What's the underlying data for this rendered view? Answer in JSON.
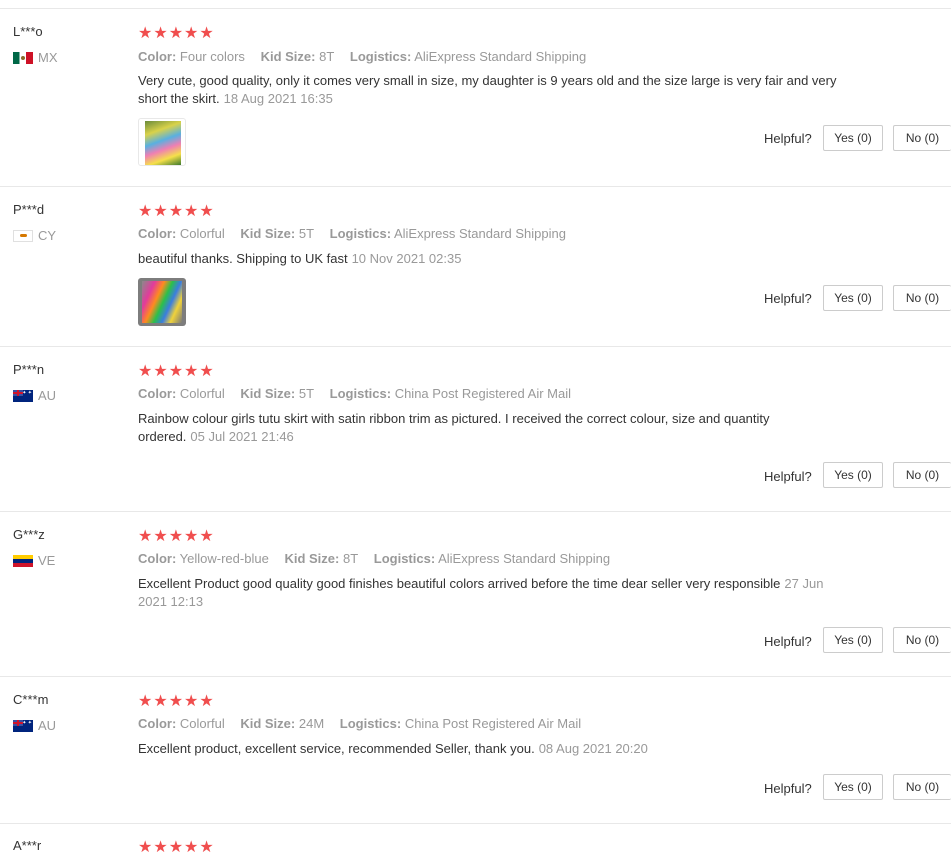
{
  "helpful_label": "Helpful?",
  "colors": {
    "star": "#f04e4e",
    "border": "#e8e8e8",
    "muted": "#999999"
  },
  "reviews": [
    {
      "user": "L***o",
      "country": "MX",
      "flag": "mexico-flag-icon",
      "stars": "★★★★★",
      "color_label": "Color:",
      "color": "Four colors",
      "size_label": "Kid Size:",
      "size": "8T",
      "logistics_label": "Logistics:",
      "logistics": "AliExpress Standard Shipping",
      "text": "Very cute, good quality, only it comes very small in size, my daughter is 9 years old and the size large is very fair and very short the skirt.",
      "date": "18 Aug 2021 16:35",
      "yes": "Yes (0)",
      "no": "No (0)",
      "has_photo": true
    },
    {
      "user": "P***d",
      "country": "CY",
      "flag": "cyprus-flag-icon",
      "stars": "★★★★★",
      "color_label": "Color:",
      "color": "Colorful",
      "size_label": "Kid Size:",
      "size": "5T",
      "logistics_label": "Logistics:",
      "logistics": "AliExpress Standard Shipping",
      "text": "beautiful thanks. Shipping to UK fast",
      "date": "10 Nov 2021 02:35",
      "yes": "Yes (0)",
      "no": "No (0)",
      "has_photo": true
    },
    {
      "user": "P***n",
      "country": "AU",
      "flag": "australia-flag-icon",
      "stars": "★★★★★",
      "color_label": "Color:",
      "color": "Colorful",
      "size_label": "Kid Size:",
      "size": "5T",
      "logistics_label": "Logistics:",
      "logistics": "China Post Registered Air Mail",
      "text": "Rainbow colour girls tutu skirt with satin ribbon trim as pictured. I received the correct colour, size and quantity ordered.",
      "date": "05 Jul 2021 21:46",
      "yes": "Yes (0)",
      "no": "No (0)",
      "has_photo": false
    },
    {
      "user": "G***z",
      "country": "VE",
      "flag": "venezuela-flag-icon",
      "stars": "★★★★★",
      "color_label": "Color:",
      "color": "Yellow-red-blue",
      "size_label": "Kid Size:",
      "size": "8T",
      "logistics_label": "Logistics:",
      "logistics": "AliExpress Standard Shipping",
      "text": "Excellent Product good quality good finishes beautiful colors arrived before the time dear seller very responsible",
      "date": "27 Jun 2021 12:13",
      "yes": "Yes (0)",
      "no": "No (0)",
      "has_photo": false
    },
    {
      "user": "C***m",
      "country": "AU",
      "flag": "australia-flag-icon",
      "stars": "★★★★★",
      "color_label": "Color:",
      "color": "Colorful",
      "size_label": "Kid Size:",
      "size": "24M",
      "logistics_label": "Logistics:",
      "logistics": "China Post Registered Air Mail",
      "text": "Excellent product, excellent service, recommended Seller, thank you.",
      "date": "08 Aug 2021 20:20",
      "yes": "Yes (0)",
      "no": "No (0)",
      "has_photo": false
    },
    {
      "user": "A***r",
      "stars": "★★★★★"
    }
  ]
}
